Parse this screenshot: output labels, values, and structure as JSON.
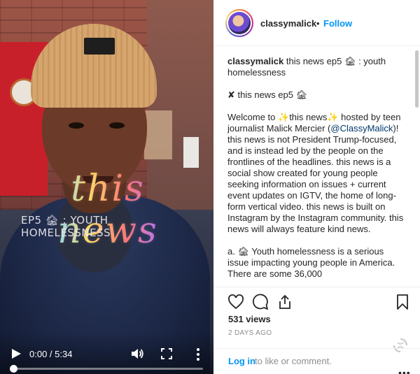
{
  "video": {
    "overlay_title": "this news",
    "overlay_subtitle": "EP5 🏚 : YOUTH HOMELESSNESS",
    "time_display": "0:00 / 5:34",
    "progress": 0.0
  },
  "post": {
    "username": "classymalick",
    "separator": "•",
    "follow_label": "Follow",
    "caption": {
      "username": "classymalick",
      "lines_1": " this news ep5 🏚 : youth homelessness",
      "line_2": "✘ this news ep5 🏚",
      "para_a_1": "Welcome to ✨this news✨ hosted by teen journalist Malick Mercier (",
      "mention": "@ClassyMalick",
      "para_a_2": ")! this news is not President Trump-focused, and is instead led by the people on the frontlines of the headlines. this news is a social show created for young people seeking information on issues + current event updates on IGTV, the home of long-form vertical video. this news is built on Instagram by the Instagram community. this news will always feature kind news.",
      "para_b": "a. 🏚 Youth homelessness is a serious issue impacting young people in America. There are some 36,000"
    },
    "views": "531 views",
    "time_ago": "2 DAYS AGO",
    "login_link": "Log in",
    "login_rest": " to like or comment.",
    "more_dots": "•••"
  },
  "icons": {
    "play": "play-icon",
    "volume": "volume-icon",
    "fullscreen": "fullscreen-icon",
    "more": "more-vertical-icon",
    "like": "heart-icon",
    "comment": "comment-icon",
    "share": "share-icon",
    "save": "bookmark-icon",
    "loader": "loading-spinner-icon"
  },
  "colors": {
    "link_blue": "#0095f6",
    "mention": "#00376b",
    "muted": "#8e8e8e"
  }
}
